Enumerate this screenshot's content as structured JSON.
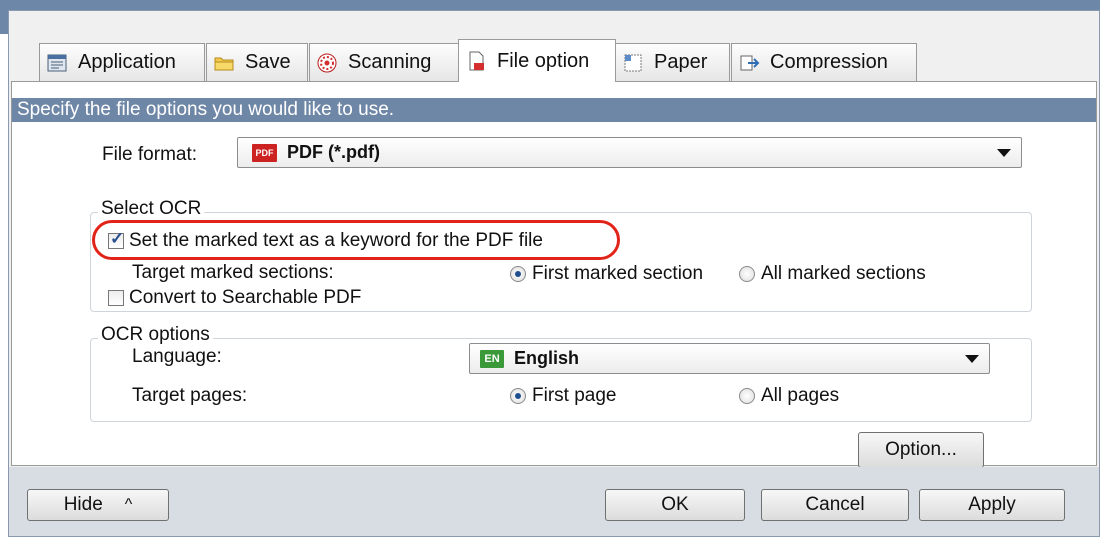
{
  "tabs": [
    {
      "label": "Application",
      "icon": "application-icon"
    },
    {
      "label": "Save",
      "icon": "folder-icon"
    },
    {
      "label": "Scanning",
      "icon": "scanning-icon"
    },
    {
      "label": "File option",
      "icon": "file-option-icon",
      "active": true
    },
    {
      "label": "Paper",
      "icon": "paper-icon"
    },
    {
      "label": "Compression",
      "icon": "compression-icon"
    }
  ],
  "instruction": "Specify the file options you would like to use.",
  "file_format": {
    "label": "File format:",
    "selected": "PDF (*.pdf)",
    "badge": "PDF"
  },
  "select_ocr": {
    "title": "Select OCR",
    "keyword_checkbox": {
      "label": "Set the marked text as a keyword for the PDF file",
      "checked": true
    },
    "target_marked_sections_label": "Target marked sections:",
    "radio_first": {
      "label": "First marked section",
      "checked": true
    },
    "radio_all": {
      "label": "All marked sections",
      "checked": false
    },
    "searchable_checkbox": {
      "label": "Convert to Searchable PDF",
      "checked": false
    }
  },
  "ocr_options": {
    "title": "OCR options",
    "language_label": "Language:",
    "language_selected": "English",
    "language_badge": "EN",
    "target_pages_label": "Target pages:",
    "radio_first_page": {
      "label": "First page",
      "checked": true
    },
    "radio_all_pages": {
      "label": "All pages",
      "checked": false
    }
  },
  "option_button": "Option...",
  "bottom": {
    "hide_label": "Hide",
    "hide_chevron": "^",
    "ok_label": "OK",
    "cancel_label": "Cancel",
    "apply_label": "Apply"
  },
  "colors": {
    "title_bar": "#6c87a8",
    "instruction_bar": "#6f87a7",
    "highlight": "#e2231a",
    "pdf_badge": "#cc2222",
    "en_badge": "#3a9a3a"
  }
}
